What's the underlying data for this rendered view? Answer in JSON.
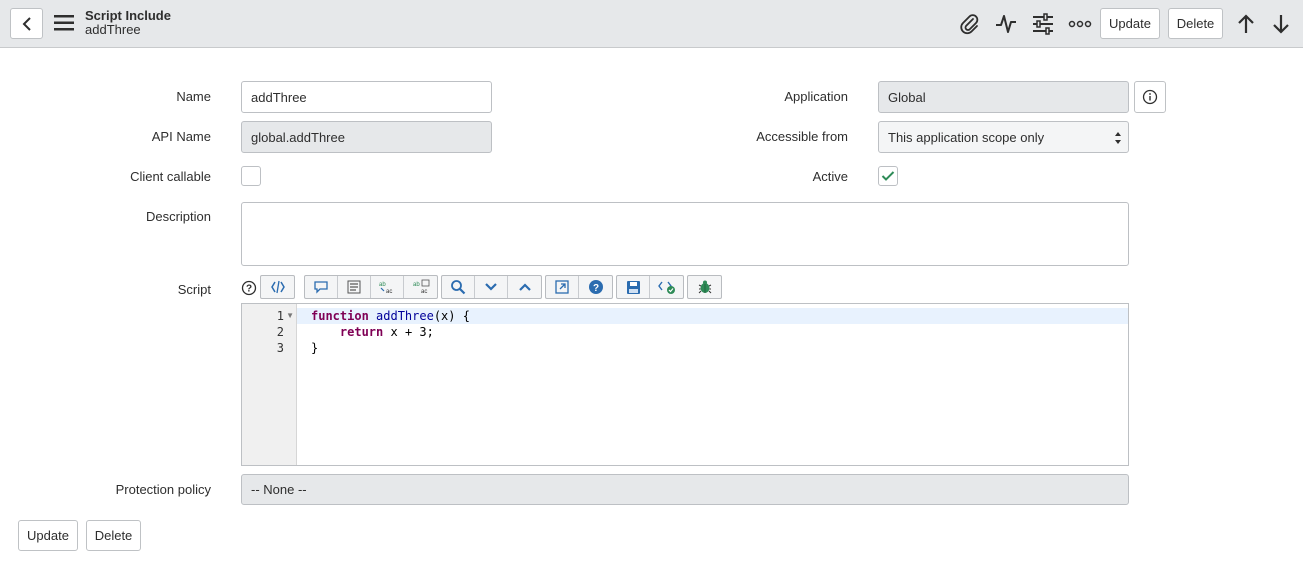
{
  "header": {
    "title": "Script Include",
    "subtitle": "addThree",
    "update_label": "Update",
    "delete_label": "Delete"
  },
  "form": {
    "name": {
      "label": "Name",
      "value": "addThree"
    },
    "api_name": {
      "label": "API Name",
      "value": "global.addThree"
    },
    "client_callable": {
      "label": "Client callable",
      "checked": false
    },
    "description": {
      "label": "Description",
      "value": ""
    },
    "script": {
      "label": "Script"
    },
    "application": {
      "label": "Application",
      "value": "Global"
    },
    "accessible_from": {
      "label": "Accessible from",
      "value": "This application scope only"
    },
    "active": {
      "label": "Active",
      "checked": true
    },
    "protection_policy": {
      "label": "Protection policy",
      "value": "-- None --"
    }
  },
  "editor": {
    "line_numbers": [
      "1",
      "2",
      "3"
    ],
    "lines": [
      {
        "keyword": "function",
        "fn": "addThree",
        "rest": "(x) {"
      },
      {
        "indent": "    ",
        "keyword": "return",
        "rest": " x + 3;"
      },
      {
        "rest": "}"
      }
    ]
  },
  "footer": {
    "update_label": "Update",
    "delete_label": "Delete"
  },
  "colors": {
    "header_bg": "#e6e8ea",
    "readonly_bg": "#e6e8ea",
    "check_green": "#2e8b57",
    "toolbar_blue": "#2b6cb0"
  }
}
